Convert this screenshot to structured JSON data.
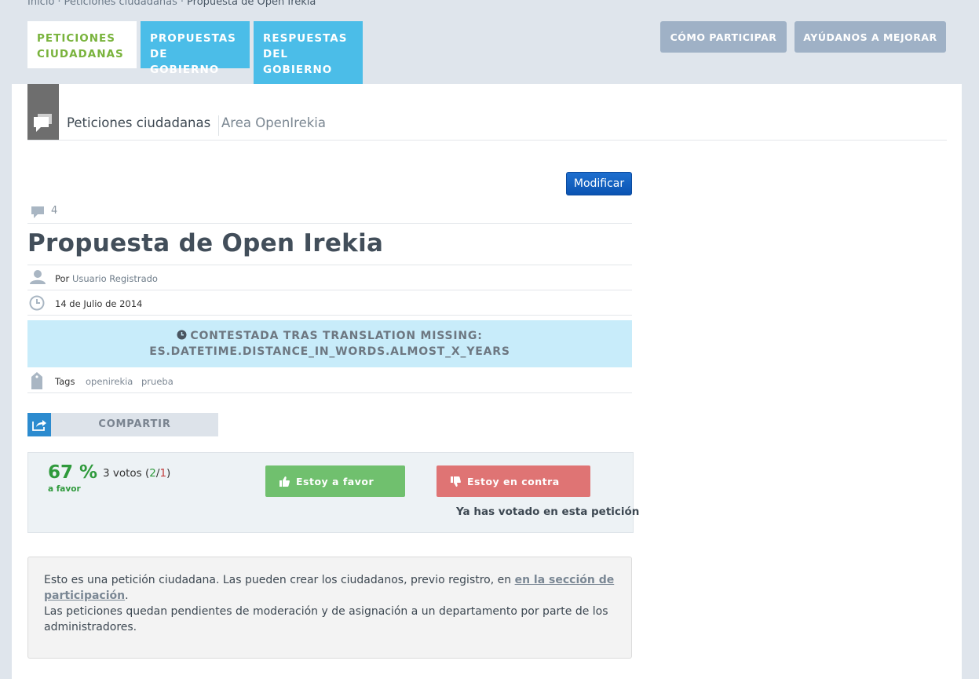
{
  "breadcrumb": {
    "items": [
      "Inicio",
      "Peticiones ciudadanas"
    ],
    "separator": "·",
    "current": "Propuesta de Open Irekia"
  },
  "tabs": {
    "peticiones": "PETICIONES CIUDADANAS",
    "propuestas": "PROPUESTAS DE GOBIERNO",
    "respuestas": "RESPUESTAS DEL GOBIERNO"
  },
  "top_buttons": {
    "como": "CÓMO PARTICIPAR",
    "ayudanos": "AYÚDANOS A MEJORAR"
  },
  "section": {
    "title": "Peticiones ciudadanas",
    "area": "Area OpenIrekia"
  },
  "actions": {
    "modificar": "Modificar"
  },
  "petition": {
    "comments_count": "4",
    "title": "Propuesta de Open Irekia",
    "author_prefix": "Por",
    "author": "Usuario Registrado",
    "date": "14 de Julio de 2014",
    "status": "CONTESTADA TRAS TRANSLATION MISSING: ES.DATETIME.DISTANCE_IN_WORDS.ALMOST_X_YEARS",
    "tags_label": "Tags",
    "tags": [
      "openirekia",
      "prueba"
    ]
  },
  "share": {
    "label": "COMPARTIR"
  },
  "votes": {
    "percent": "67 %",
    "percent_label": "a favor",
    "total_text": "3 votos (",
    "favor_count": "2",
    "slash": "/",
    "contra_count": "1",
    "close": ")",
    "favor_button": "Estoy a favor",
    "contra_button": "Estoy en contra",
    "voted_message": "Ya has votado en esta petición"
  },
  "info": {
    "text_before": "Esto es una petición ciudadana. Las pueden crear los ciudadanos, previo registro, en ",
    "link": "en la sección de participación",
    "text_after": ".",
    "line2": "Las peticiones quedan pendientes de moderación y de asignación a un departamento por parte de los administradores."
  },
  "colors": {
    "background": "#dfe5ec",
    "accent_green": "#79b33c",
    "tab_blue": "#4bbde8",
    "favor_green": "#70c06e",
    "contra_red": "#df7474",
    "status_bg": "#c8ecfa",
    "modificar_blue": "#0b54b3"
  }
}
